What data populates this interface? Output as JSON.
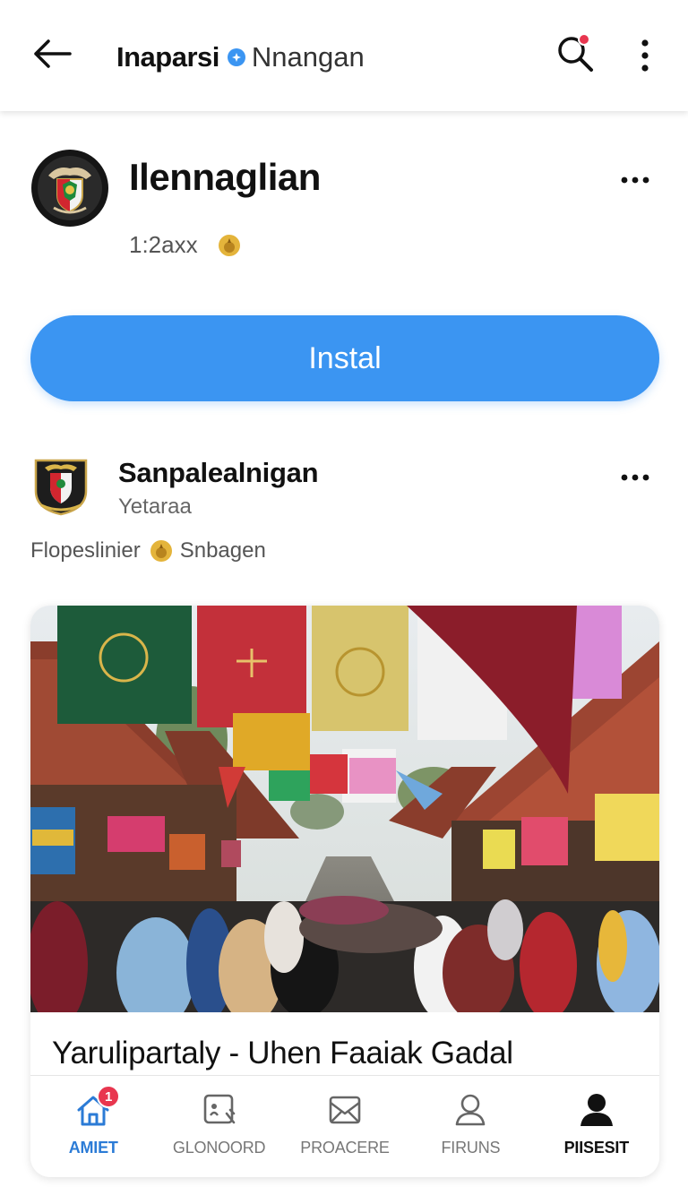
{
  "header": {
    "title": "Inaparsi",
    "subtitle": "Nnangan"
  },
  "profile": {
    "name": "Ilennaglian",
    "meta": "1:2axx",
    "install_label": "Instal"
  },
  "post": {
    "author": "Sanpalealnigan",
    "handle": "Yetaraa",
    "meta_left": "Flopeslinier",
    "meta_right": "Snbagen",
    "caption": "Yarulipartaly - Uhen Faaiak Gadal"
  },
  "nav": {
    "items": [
      {
        "label": "AMIET",
        "icon": "home-icon",
        "badge": "1",
        "active": true
      },
      {
        "label": "GLONOORD",
        "icon": "profile-card-icon"
      },
      {
        "label": "PROACERE",
        "icon": "envelope-icon"
      },
      {
        "label": "FIRUNS",
        "icon": "user-outline-icon"
      },
      {
        "label": "PIISESIT",
        "icon": "user-filled-icon"
      }
    ]
  },
  "colors": {
    "accent": "#3b95f2",
    "active_nav": "#2b7bd6",
    "badge": "#e8364f"
  }
}
